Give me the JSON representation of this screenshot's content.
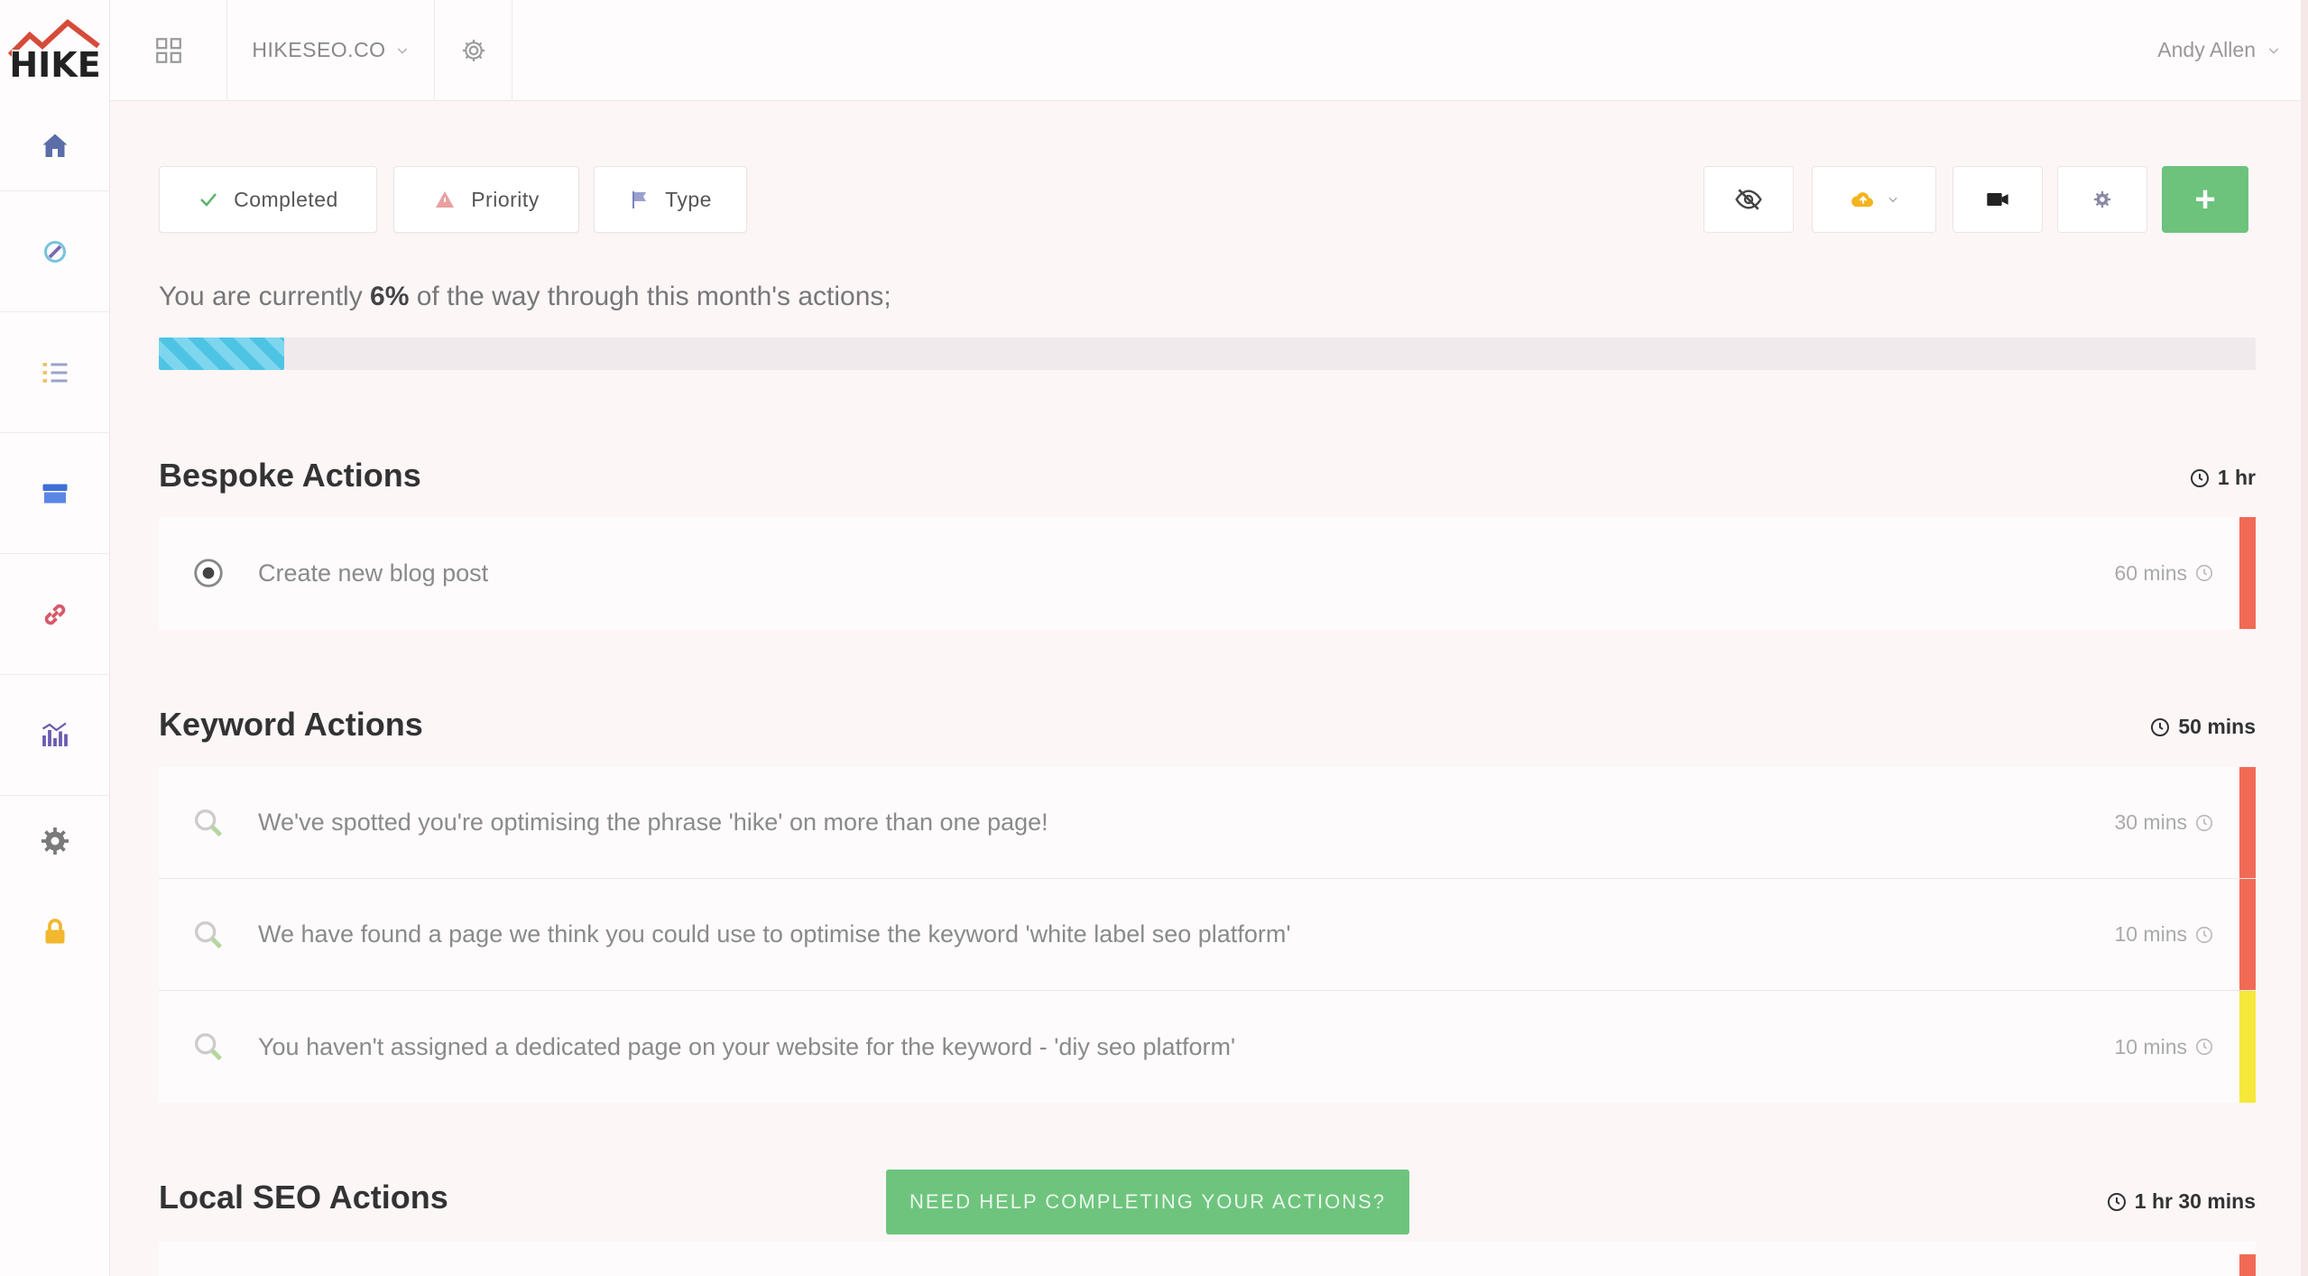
{
  "app": {
    "logo_text": "HIKE",
    "site_name": "HIKESEO.CO",
    "user_name": "Andy Allen"
  },
  "sidebar": {
    "items": [
      {
        "icon": "home-icon"
      },
      {
        "icon": "rocket-icon"
      },
      {
        "icon": "checklist-icon"
      },
      {
        "icon": "store-icon"
      },
      {
        "icon": "link-icon"
      },
      {
        "icon": "chart-icon"
      },
      {
        "icon": "gear-icon"
      },
      {
        "icon": "lock-icon"
      }
    ]
  },
  "toolbar": {
    "completed_label": "Completed",
    "priority_label": "Priority",
    "type_label": "Type",
    "add_label": "+"
  },
  "progress": {
    "prefix": "You are currently ",
    "percent_text": "6%",
    "suffix": " of the way through this month's actions;",
    "percent_value": 6
  },
  "sections": {
    "bespoke": {
      "title": "Bespoke Actions",
      "total_time": "1 hr",
      "actions": [
        {
          "text": "Create new blog post",
          "time": "60 mins",
          "priority_color": "#f06a55"
        }
      ]
    },
    "keyword": {
      "title": "Keyword Actions",
      "total_time": "50 mins",
      "actions": [
        {
          "text": "We've spotted you're optimising the phrase 'hike' on more than one page!",
          "time": "30 mins",
          "priority_color": "#f06a55"
        },
        {
          "text": "We have found a page we think you could use to optimise the keyword 'white label seo platform'",
          "time": "10 mins",
          "priority_color": "#f06a55"
        },
        {
          "text": "You haven't assigned a dedicated page on your website for the keyword - 'diy seo platform'",
          "time": "10 mins",
          "priority_color": "#f5e83a"
        }
      ]
    },
    "local": {
      "title": "Local SEO Actions",
      "total_time": "1 hr 30 mins"
    }
  },
  "help_button": "NEED HELP COMPLETING YOUR ACTIONS?",
  "colors": {
    "accent_green": "#6dc27c",
    "progress_blue": "#4ec4e4",
    "priority_high": "#f06a55",
    "priority_medium": "#f5e83a"
  }
}
